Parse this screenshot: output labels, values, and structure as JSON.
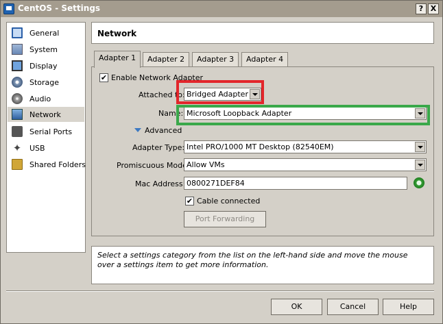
{
  "window": {
    "title": "CentOS - Settings",
    "help_glyph": "?",
    "close_glyph": "X"
  },
  "sidebar": {
    "items": [
      {
        "label": "General",
        "icon": "general-icon"
      },
      {
        "label": "System",
        "icon": "system-icon"
      },
      {
        "label": "Display",
        "icon": "display-icon"
      },
      {
        "label": "Storage",
        "icon": "storage-icon"
      },
      {
        "label": "Audio",
        "icon": "audio-icon"
      },
      {
        "label": "Network",
        "icon": "network-icon",
        "selected": true
      },
      {
        "label": "Serial Ports",
        "icon": "serial-ports-icon"
      },
      {
        "label": "USB",
        "icon": "usb-icon"
      },
      {
        "label": "Shared Folders",
        "icon": "shared-folders-icon"
      }
    ]
  },
  "header": {
    "title": "Network"
  },
  "tabs": [
    {
      "label": "Adapter 1",
      "active": true
    },
    {
      "label": "Adapter 2"
    },
    {
      "label": "Adapter 3"
    },
    {
      "label": "Adapter 4"
    }
  ],
  "form": {
    "enable_label": "Enable Network Adapter",
    "enable_checked": true,
    "attached_label": "Attached to:",
    "attached_value": "Bridged Adapter",
    "name_label": "Name:",
    "name_value": "Microsoft Loopback Adapter",
    "advanced_label": "Advanced",
    "adapter_type_label": "Adapter Type:",
    "adapter_type_value": "Intel PRO/1000 MT Desktop (82540EM)",
    "promiscuous_label": "Promiscuous Mode:",
    "promiscuous_value": "Allow VMs",
    "mac_label": "Mac Address:",
    "mac_value": "0800271DEF84",
    "cable_label": "Cable connected",
    "cable_checked": true,
    "port_forwarding_label": "Port Forwarding",
    "check_glyph": "✔"
  },
  "info": {
    "text": "Select a settings category from the list on the left-hand side and move the mouse over a settings item to get more information."
  },
  "buttons": {
    "ok": "OK",
    "cancel": "Cancel",
    "help": "Help"
  },
  "annotations": {
    "red_color": "#e2262b",
    "green_color": "#3aa84a"
  }
}
